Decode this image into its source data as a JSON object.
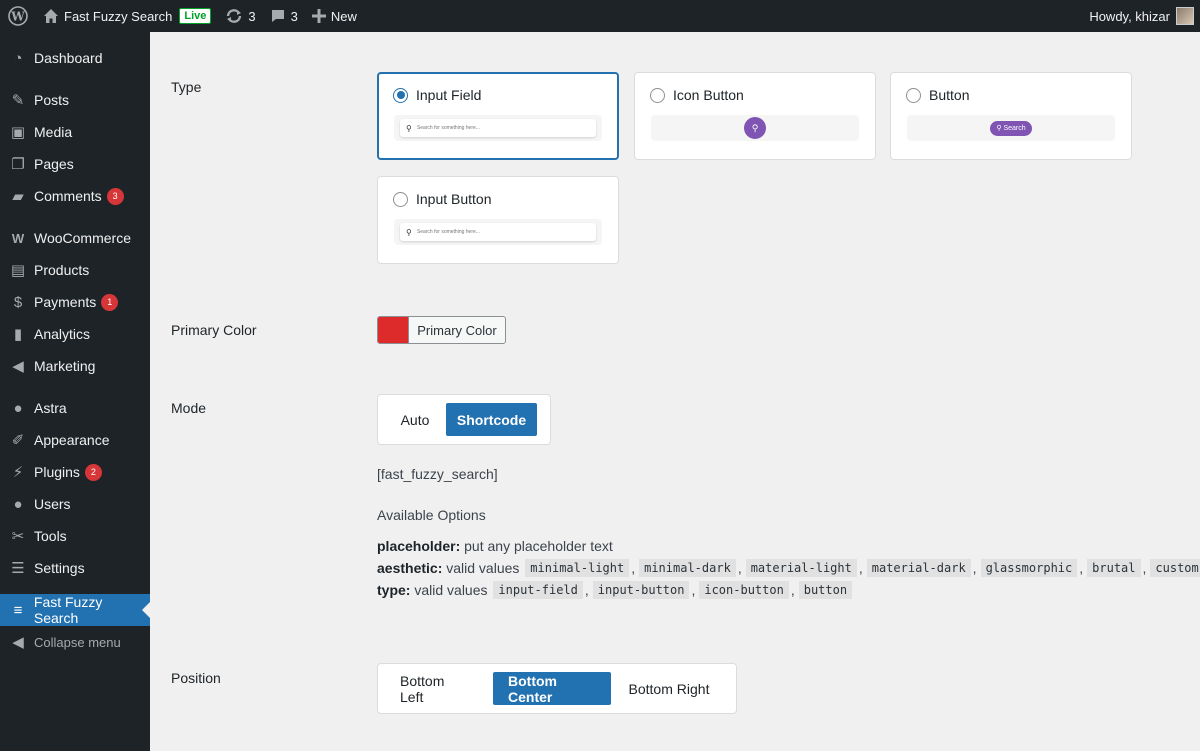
{
  "adminbar": {
    "site_name": "Fast Fuzzy Search",
    "live_badge": "Live",
    "updates_count": "3",
    "comments_count": "3",
    "new_label": "New",
    "howdy": "Howdy, khizar"
  },
  "sidebar": {
    "items": [
      {
        "label": "Dashboard",
        "icon": "dashboard-icon"
      },
      {
        "label": "Posts",
        "icon": "pin-icon"
      },
      {
        "label": "Media",
        "icon": "media-icon"
      },
      {
        "label": "Pages",
        "icon": "pages-icon"
      },
      {
        "label": "Comments",
        "icon": "comment-icon",
        "badge": "3"
      },
      {
        "label": "WooCommerce",
        "icon": "woo-icon"
      },
      {
        "label": "Products",
        "icon": "archive-icon"
      },
      {
        "label": "Payments",
        "icon": "dollar-icon",
        "badge": "1"
      },
      {
        "label": "Analytics",
        "icon": "bar-chart-icon"
      },
      {
        "label": "Marketing",
        "icon": "megaphone-icon"
      },
      {
        "label": "Astra",
        "icon": "astra-icon"
      },
      {
        "label": "Appearance",
        "icon": "brush-icon"
      },
      {
        "label": "Plugins",
        "icon": "plug-icon",
        "badge": "2"
      },
      {
        "label": "Users",
        "icon": "user-icon"
      },
      {
        "label": "Tools",
        "icon": "wrench-icon"
      },
      {
        "label": "Settings",
        "icon": "sliders-icon"
      },
      {
        "label": "Fast Fuzzy Search",
        "icon": "fuzzy-icon"
      }
    ],
    "collapse_label": "Collapse menu"
  },
  "form": {
    "type_label": "Type",
    "types": [
      {
        "label": "Input Field",
        "selected": true,
        "preview_text": "Search for something here..."
      },
      {
        "label": "Icon Button",
        "selected": false
      },
      {
        "label": "Button",
        "selected": false,
        "preview_text": "Search"
      },
      {
        "label": "Input Button",
        "selected": false,
        "preview_text": "Search for something here..."
      }
    ],
    "primary_color_label": "Primary Color",
    "primary_color_button": "Primary Color",
    "primary_color_value": "#dd2a2a",
    "accent_color": "#2271b1",
    "preview_accent": "#7f54b3",
    "mode_label": "Mode",
    "mode_options": [
      "Auto",
      "Shortcode"
    ],
    "mode_selected": "Shortcode",
    "shortcode": "[fast_fuzzy_search]",
    "available_options_title": "Available Options",
    "placeholder_key": "placeholder:",
    "placeholder_desc": "put any placeholder text",
    "aesthetic_key": "aesthetic:",
    "aesthetic_desc": "valid values",
    "aesthetic_values": [
      "minimal-light",
      "minimal-dark",
      "material-light",
      "material-dark",
      "glassmorphic",
      "brutal",
      "custom"
    ],
    "type_key": "type:",
    "type_desc": "valid values",
    "type_values": [
      "input-field",
      "input-button",
      "icon-button",
      "button"
    ],
    "position_label": "Position",
    "position_options": [
      "Bottom Left",
      "Bottom Center",
      "Bottom Right"
    ],
    "position_selected": "Bottom Center"
  }
}
